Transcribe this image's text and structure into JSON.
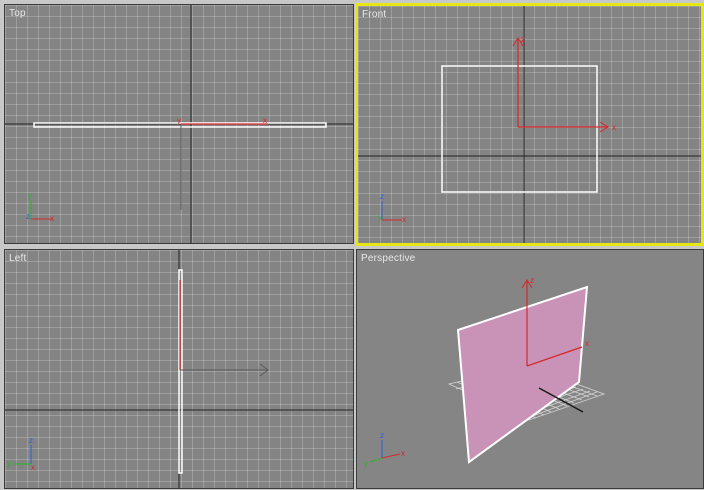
{
  "viewports": {
    "top": {
      "label": "Top",
      "active": false
    },
    "front": {
      "label": "Front",
      "active": true
    },
    "left": {
      "label": "Left",
      "active": false
    },
    "perspective": {
      "label": "Perspective",
      "active": false
    }
  },
  "axis_labels": {
    "x": "x",
    "y": "y",
    "z": "z"
  },
  "colors": {
    "viewport_bg": "#848484",
    "active_border": "#e6e615",
    "axis_x": "#d62828",
    "axis_y": "#25b825",
    "axis_z": "#2a5fd6",
    "plane_fill": "#c993b8",
    "selection_white": "#ffffff"
  },
  "icons": [
    "axis-tripod-icon",
    "move-gizmo-icon"
  ]
}
